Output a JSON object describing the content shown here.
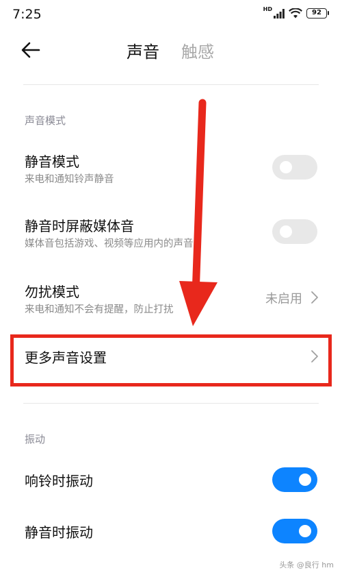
{
  "status_bar": {
    "time": "7:25",
    "network_badge": "HD",
    "battery": "92"
  },
  "header": {
    "tabs": [
      {
        "label": "声音",
        "active": true
      },
      {
        "label": "触感",
        "active": false
      }
    ]
  },
  "sections": {
    "sound_mode": {
      "title": "声音模式",
      "items": [
        {
          "title": "静音模式",
          "subtitle": "来电和通知铃声静音",
          "toggle": false
        },
        {
          "title": "静音时屏蔽媒体音",
          "subtitle": "媒体音包括游戏、视频等应用内的声音",
          "toggle": false
        },
        {
          "title": "勿扰模式",
          "subtitle": "来电和通知不会有提醒，防止打扰",
          "value": "未启用"
        },
        {
          "title": "更多声音设置",
          "highlighted": true
        }
      ]
    },
    "vibration": {
      "title": "振动",
      "items": [
        {
          "title": "响铃时振动",
          "toggle": true
        },
        {
          "title": "静音时振动",
          "toggle": true
        }
      ]
    }
  },
  "annotation": {
    "color": "#e8281c"
  },
  "colors": {
    "accent": "#0d84ff",
    "toggle_off": "#e8e8e8"
  },
  "watermark": "头条 @良行 hm"
}
